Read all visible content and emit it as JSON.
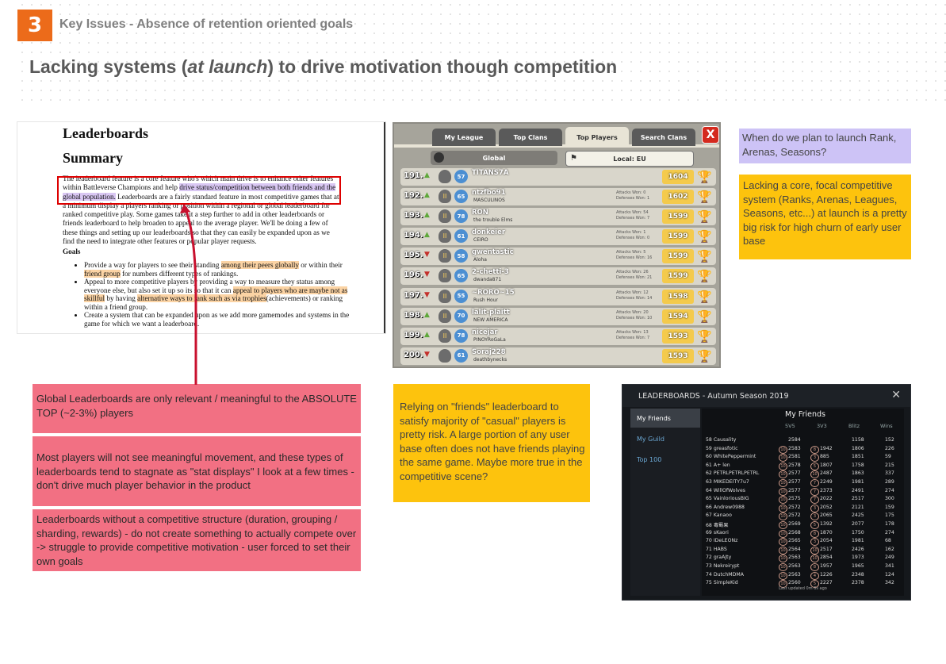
{
  "header": {
    "number": "3",
    "section": "Key Issues - Absence of retention oriented goals",
    "title_prefix": "Lacking systems (",
    "title_emph": "at launch",
    "title_suffix": ") to drive motivation though competition"
  },
  "doc": {
    "heading": "Leaderboards",
    "subheading": "Summary",
    "para_1": "The leaderboard feature is a core feature who's which main drive is to enhance other features within Battleverse Champions and help ",
    "para_hl": "drive status/competition between both friends and the global population.",
    "para_2": " Leaderboards are a fairly standard feature in most competitive games that at a minimum display a players ranking or position within a regional or global leaderboard for ranked competitive play. Some games take it a step further to add in other leaderboards or friends leaderboard to help broaden to appeal to the average player. We'll be doing a few of these things and setting up our leaderboards so that they can easily be expanded upon as we find the need to integrate other features or popular player requests.",
    "goals_heading": "Goals",
    "goals": [
      {
        "a": "Provide a way for players to see their standing ",
        "hl1": "among their peers globally",
        "b": " or within their ",
        "hl2": "friend group",
        "c": " for numbers different types of rankings."
      },
      {
        "a": "Appeal to more competitive players by providing a way to measure they status among everyone else, but also set it up so its so that it can ",
        "hl1": "appeal to players who are maybe not as skillful",
        "b": " by having ",
        "hl2": "alternative ways to rank such as via trophies",
        "c": "(achievements) or ranking within a friend group."
      },
      {
        "a": "Create a system that can be expanded upon as we add more gamemodes and systems in the game for which we want a leaderboard.",
        "hl1": "",
        "b": "",
        "hl2": "",
        "c": ""
      }
    ]
  },
  "game": {
    "tabs": [
      "My League",
      "Top Clans",
      "Top Players",
      "Search Clans"
    ],
    "active_tab": "Top Players",
    "close": "X",
    "global_btn": "Global",
    "local_btn": "Local: EU",
    "rows": [
      {
        "rank": "191.",
        "dir": "up",
        "league": "",
        "level": "57",
        "name": "TITANS7A",
        "clan": "",
        "attacks": "",
        "defenses": "",
        "trophies": "1604"
      },
      {
        "rank": "192.",
        "dir": "up",
        "league": "II",
        "level": "65",
        "name": "ntzfbo91",
        "clan": "MASCULINOS",
        "attacks": "Attacks Won: 0",
        "defenses": "Defenses Won: 1",
        "trophies": "1602"
      },
      {
        "rank": "193.",
        "dir": "up",
        "league": "II",
        "level": "78",
        "name": "RON",
        "clan": "the trouble Elms",
        "attacks": "Attacks Won: 54",
        "defenses": "Defenses Won: 7",
        "trophies": "1599"
      },
      {
        "rank": "194.",
        "dir": "up",
        "league": "II",
        "level": "61",
        "name": "donkeier",
        "clan": "CEIRO",
        "attacks": "Attacks Won: 1",
        "defenses": "Defenses Won: 0",
        "trophies": "1599"
      },
      {
        "rank": "195.",
        "dir": "down",
        "league": "II",
        "level": "58",
        "name": "gwentastic",
        "clan": "Aloha",
        "attacks": "Attacks Won: 5",
        "defenses": "Defenses Won: 16",
        "trophies": "1599"
      },
      {
        "rank": "196.",
        "dir": "down",
        "league": "II",
        "level": "65",
        "name": "2-chetti-3",
        "clan": "dwanda871",
        "attacks": "Attacks Won: 26",
        "defenses": "Defenses Won: 21",
        "trophies": "1599"
      },
      {
        "rank": "197.",
        "dir": "down",
        "league": "II",
        "level": "55",
        "name": "~RORO~15",
        "clan": "Rush Hour",
        "attacks": "Attacks Won: 12",
        "defenses": "Defenses Won: 14",
        "trophies": "1598"
      },
      {
        "rank": "198.",
        "dir": "up",
        "league": "II",
        "level": "70",
        "name": "lalit-plaitt",
        "clan": "NEW AMERICA",
        "attacks": "Attacks Won: 20",
        "defenses": "Defenses Won: 10",
        "trophies": "1594"
      },
      {
        "rank": "199.",
        "dir": "up",
        "league": "II",
        "level": "78",
        "name": "nicejar",
        "clan": "PINOYRoGaLa",
        "attacks": "Attacks Won: 13",
        "defenses": "Defenses Won: 7",
        "trophies": "1593"
      },
      {
        "rank": "200.",
        "dir": "down",
        "league": "",
        "level": "61",
        "name": "Soraj228",
        "clan": "deathbynecks",
        "attacks": "",
        "defenses": "",
        "trophies": "1593"
      }
    ]
  },
  "notes": {
    "lavender": "When do we plan to launch Rank, Arenas, Seasons?",
    "yellow_right": "Lacking a core, focal competitive system (Ranks, Arenas, Leagues, Seasons, etc...) at launch is a pretty big risk for high churn of early user base",
    "pink_1": "Global Leaderboards are only relevant / meaningful to  the ABSOLUTE TOP (~2-3%) players",
    "pink_2": "Most players will not see meaningful movement, and these types of leaderboards tend to stagnate as \"stat displays\" I look at a few times - don't drive much player behavior in the product",
    "pink_3": "Leaderboards without a competitive structure (duration, grouping / sharding, rewards) - do not create something to actually compete over  -> struggle to provide competitive motivation - user forced to set their own goals",
    "yellow_mid": "Relying on \"friends\" leaderboard to satisfy majority of \"casual\" players is pretty risk. A large portion of any user base often does not have friends playing the same game. Maybe more true in the competitive scene?"
  },
  "dark": {
    "title": "LEADERBOARDS - Autumn Season 2019",
    "close": "✕",
    "side": [
      "My Friends",
      "My Guild",
      "Top 100"
    ],
    "main_title": "My Friends",
    "cols": [
      "5V5",
      "3V3",
      "Blitz",
      "Wins"
    ],
    "rows": [
      {
        "n": "58 Causality",
        "b1": "",
        "v1": "2584",
        "b2": "",
        "v2": "",
        "blitz": "1158",
        "wins": "152"
      },
      {
        "n": "59 greasfotic",
        "b1": "10",
        "v1": "2583",
        "b2": "8",
        "v2": "1942",
        "blitz": "1806",
        "wins": "226"
      },
      {
        "n": "60 WhitePeppermint",
        "b1": "10",
        "v1": "2581",
        "b2": "3",
        "v2": "885",
        "blitz": "1851",
        "wins": "59"
      },
      {
        "n": "61 A+ len",
        "b1": "10",
        "v1": "2578",
        "b2": "5",
        "v2": "1807",
        "blitz": "1758",
        "wins": "215"
      },
      {
        "n": "62 PETRLPETRLPETRL",
        "b1": "10",
        "v1": "2577",
        "b2": "10",
        "v2": "2487",
        "blitz": "1863",
        "wins": "337"
      },
      {
        "n": "63 MIKEDEITY7u7",
        "b1": "10",
        "v1": "2577",
        "b2": "7",
        "v2": "2249",
        "blitz": "1981",
        "wins": "289"
      },
      {
        "n": "64 WillOfWolves",
        "b1": "10",
        "v1": "2577",
        "b2": "7",
        "v2": "2373",
        "blitz": "2491",
        "wins": "274"
      },
      {
        "n": "65 VainloriousBIG",
        "b1": "10",
        "v1": "2575",
        "b2": "7",
        "v2": "2022",
        "blitz": "2517",
        "wins": "300"
      },
      {
        "n": "66 Andrew0988",
        "b1": "10",
        "v1": "2572",
        "b2": "3",
        "v2": "2052",
        "blitz": "2121",
        "wins": "159"
      },
      {
        "n": "67 Kanaoo",
        "b1": "10",
        "v1": "2572",
        "b2": "3",
        "v2": "2065",
        "blitz": "2425",
        "wins": "175"
      },
      {
        "n": "68 毒蜀果",
        "b1": "10",
        "v1": "2569",
        "b2": "5",
        "v2": "1392",
        "blitz": "2077",
        "wins": "178"
      },
      {
        "n": "69 sKaori",
        "b1": "10",
        "v1": "2568",
        "b2": "8",
        "v2": "1870",
        "blitz": "1750",
        "wins": "274"
      },
      {
        "n": "70 IDeLEONz",
        "b1": "10",
        "v1": "2565",
        "b2": "3",
        "v2": "2054",
        "blitz": "1981",
        "wins": "68"
      },
      {
        "n": "71 HABS",
        "b1": "10",
        "v1": "2564",
        "b2": "10",
        "v2": "2517",
        "blitz": "2426",
        "wins": "162"
      },
      {
        "n": "72 graAJty",
        "b1": "10",
        "v1": "2563",
        "b2": "10",
        "v2": "2854",
        "blitz": "1973",
        "wins": "249"
      },
      {
        "n": "73 Nekreirypt",
        "b1": "10",
        "v1": "2563",
        "b2": "8",
        "v2": "1957",
        "blitz": "1965",
        "wins": "341"
      },
      {
        "n": "74 DutchMDMA",
        "b1": "10",
        "v1": "2563",
        "b2": "4",
        "v2": "1226",
        "blitz": "2348",
        "wins": "124"
      },
      {
        "n": "75 SimpleKid",
        "b1": "10",
        "v1": "2560",
        "b2": "5",
        "v2": "2227",
        "blitz": "2378",
        "wins": "342"
      }
    ],
    "footer": "Last updated 0m 6s ago"
  }
}
